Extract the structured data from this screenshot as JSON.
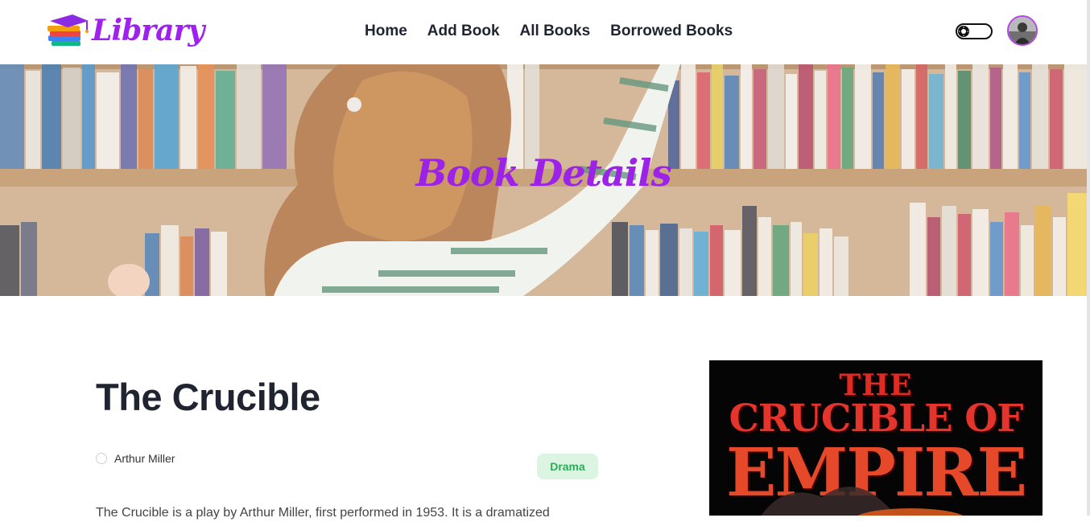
{
  "header": {
    "logo_text": "Library",
    "nav": [
      {
        "label": "Home"
      },
      {
        "label": "Add Book"
      },
      {
        "label": "All Books"
      },
      {
        "label": "Borrowed Books"
      }
    ]
  },
  "banner": {
    "title": "Book Details"
  },
  "book": {
    "title": "The Crucible",
    "author": "Arthur Miller",
    "genre": "Drama",
    "description": "The Crucible is a play by Arthur Miller, first performed in 1953. It is a dramatized",
    "cover": {
      "line1": "THE",
      "line2": "CRUCIBLE OF",
      "line3": "EMPIRE"
    }
  },
  "colors": {
    "brand_purple": "#a020f0",
    "genre_badge_bg": "#dcf5e3",
    "genre_badge_text": "#2eab56"
  }
}
